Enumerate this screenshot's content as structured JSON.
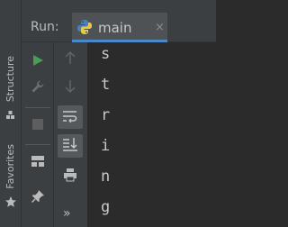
{
  "side_tabs": [
    {
      "label": "Structure",
      "icon": "structure-icon"
    },
    {
      "label": "Favorites",
      "icon": "star-icon"
    }
  ],
  "run_panel": {
    "title": "Run:",
    "tab": {
      "label": "main",
      "icon": "python-icon",
      "close": "×"
    }
  },
  "toolbar_left": [
    {
      "name": "run-button",
      "icon": "play-icon",
      "enabled": true
    },
    {
      "name": "wrench-button",
      "icon": "wrench-icon",
      "enabled": false
    },
    {
      "name": "stop-button",
      "icon": "stop-icon",
      "enabled": false
    },
    {
      "name": "layout-button",
      "icon": "layout-icon",
      "enabled": true
    },
    {
      "name": "pin-button",
      "icon": "pin-icon",
      "enabled": true
    }
  ],
  "toolbar_right": [
    {
      "name": "scroll-up-button",
      "icon": "arrow-up-icon",
      "enabled": false
    },
    {
      "name": "scroll-down-button",
      "icon": "arrow-down-icon",
      "enabled": false
    },
    {
      "name": "soft-wrap-button",
      "icon": "soft-wrap-icon",
      "active": true
    },
    {
      "name": "scroll-to-end-button",
      "icon": "scroll-to-end-icon",
      "active": true
    },
    {
      "name": "print-button",
      "icon": "print-icon",
      "enabled": true
    },
    {
      "name": "more-button",
      "label": "»"
    }
  ],
  "console": {
    "lines": [
      "s",
      "t",
      "r",
      "i",
      "n",
      "g"
    ]
  },
  "colors": {
    "panel": "#3c3f41",
    "editor": "#2b2b2b",
    "run_green": "#499c54",
    "tab_underline": "#4a88c7",
    "text": "#bbbbbb"
  }
}
